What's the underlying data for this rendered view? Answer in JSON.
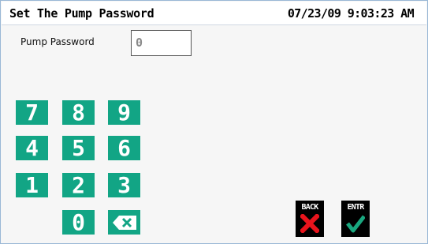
{
  "header": {
    "title": "Set The Pump Password",
    "datetime": "07/23/09 9:03:23 AM"
  },
  "password_field": {
    "label": "Pump Password",
    "value": "0"
  },
  "keypad": {
    "keys": [
      "7",
      "8",
      "9",
      "4",
      "5",
      "6",
      "1",
      "2",
      "3",
      "0"
    ],
    "backspace_icon": "backspace-icon",
    "color": "#12a585"
  },
  "actions": {
    "back_label": "BACK",
    "back_icon": "red-x-icon",
    "enter_label": "ENTR",
    "enter_icon": "green-check-icon"
  }
}
